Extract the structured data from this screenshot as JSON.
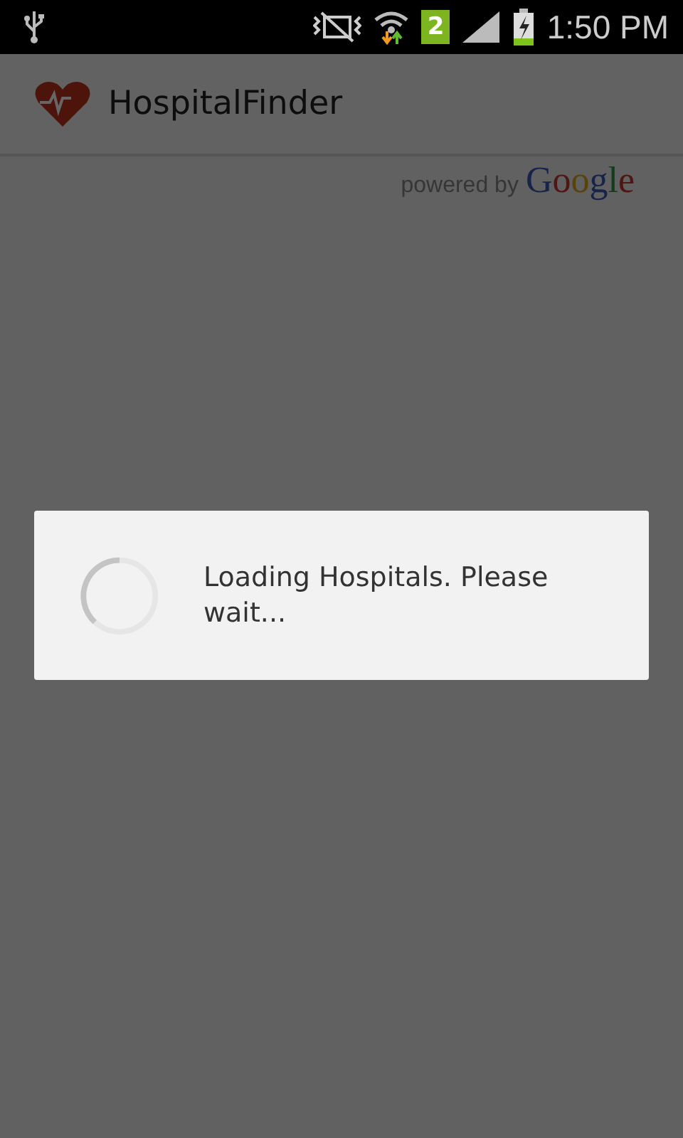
{
  "status_bar": {
    "sim_slot": "2",
    "time": "1:50 PM"
  },
  "action_bar": {
    "title": "HospitalFinder"
  },
  "attribution": {
    "prefix": "powered by",
    "brand": "Google"
  },
  "dialog": {
    "message": "Loading Hospitals. Please wait..."
  }
}
